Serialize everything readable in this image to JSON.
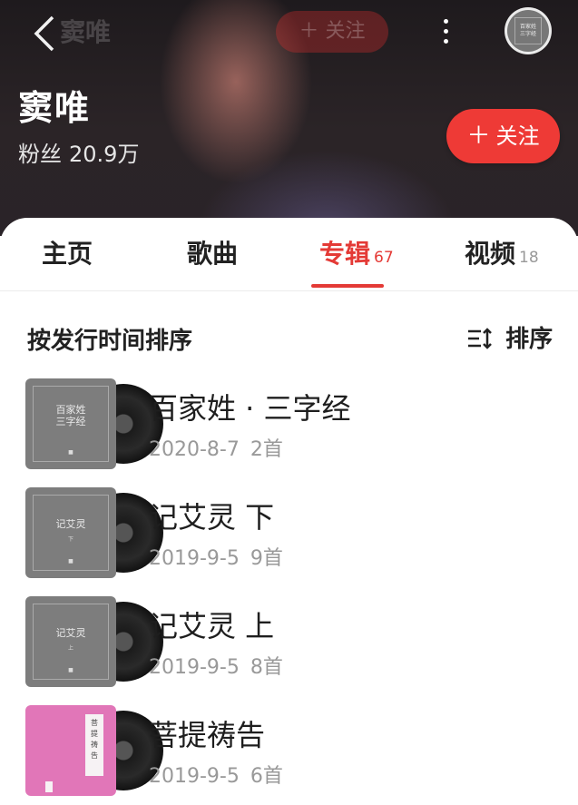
{
  "header": {
    "title": "窦唯",
    "follow_label": "关注",
    "mini_cover_text": "百家姓\n三字经"
  },
  "artist": {
    "name": "窦唯",
    "fans_label": "粉丝",
    "fans_count": "20.9万",
    "follow_label": "关注"
  },
  "tabs": [
    {
      "label": "主页",
      "count": ""
    },
    {
      "label": "歌曲",
      "count": ""
    },
    {
      "label": "专辑",
      "count": "67"
    },
    {
      "label": "视频",
      "count": "18"
    }
  ],
  "sort": {
    "label": "按发行时间排序",
    "button_label": "排序"
  },
  "albums": [
    {
      "title": "百家姓 · 三字经",
      "date": "2020-8-7",
      "tracks": "2首",
      "cover_text": "百家姓\n三字经",
      "cover_color": "#7d7d7d"
    },
    {
      "title": "记艾灵 下",
      "date": "2019-9-5",
      "tracks": "9首",
      "cover_text": "记艾灵",
      "cover_color": "#7d7d7d"
    },
    {
      "title": "记艾灵 上",
      "date": "2019-9-5",
      "tracks": "8首",
      "cover_text": "记艾灵",
      "cover_color": "#7d7d7d"
    },
    {
      "title": "菩提祷告",
      "date": "2019-9-5",
      "tracks": "6首",
      "cover_text": "菩提祷告",
      "cover_color": "#e176b8"
    }
  ],
  "colors": {
    "accent": "#e43a36",
    "follow_button": "#ee3a36"
  },
  "icons": {
    "back": "chevron-left-icon",
    "more": "more-vertical-icon",
    "plus": "plus-icon",
    "sort": "sort-icon"
  }
}
